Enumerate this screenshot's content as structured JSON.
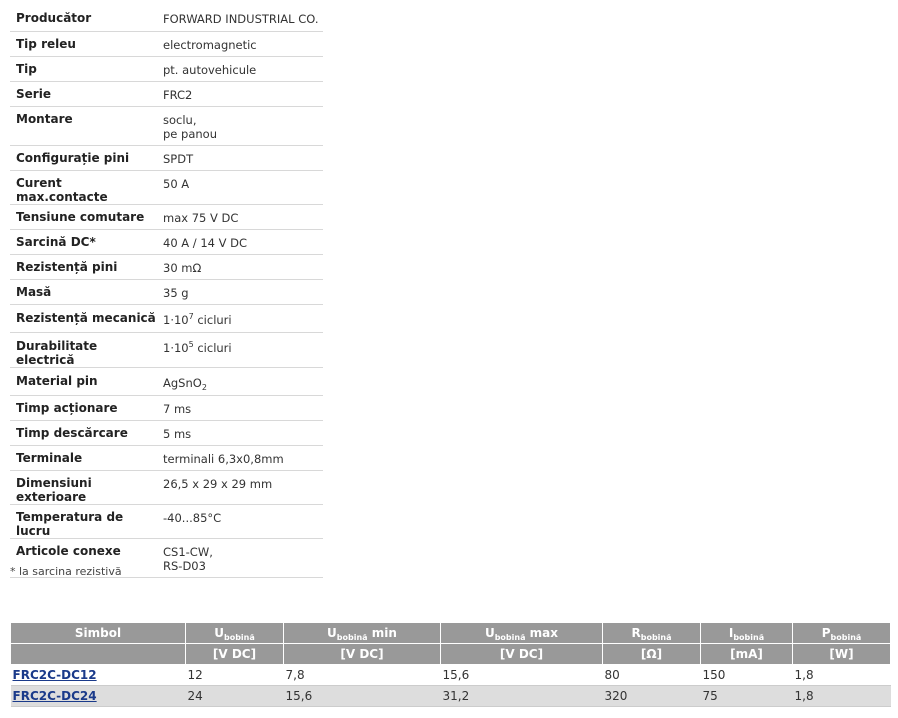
{
  "specs": [
    {
      "key": "Producător",
      "value": "FORWARD INDUSTRIAL CO."
    },
    {
      "key": "Tip releu",
      "value": "electromagnetic"
    },
    {
      "key": "Tip",
      "value": "pt. autovehicule"
    },
    {
      "key": "Serie",
      "value": "FRC2"
    },
    {
      "key": "Montare",
      "value": "soclu,",
      "value2": "pe panou"
    },
    {
      "key": "Configurație pini",
      "value": "SPDT"
    },
    {
      "key": "Curent max.contacte",
      "value": "50 A"
    },
    {
      "key": "Tensiune comutare",
      "value": "max 75 V DC"
    },
    {
      "key": "Sarcină DC*",
      "value": "40 A / 14 V DC"
    },
    {
      "key": "Rezistență pini",
      "value": "30 mΩ"
    },
    {
      "key": "Masă",
      "value": "35 g"
    },
    {
      "key": "Rezistență mecanică",
      "base": "1·10",
      "exp": "7",
      "unit": " cicluri"
    },
    {
      "key": "Durabilitate electrică",
      "base": "1·10",
      "exp": "5",
      "unit": " cicluri"
    },
    {
      "key": "Material pin",
      "base": "AgSnO",
      "sub": "2"
    },
    {
      "key": "Timp acționare",
      "value": "7 ms"
    },
    {
      "key": "Timp descărcare",
      "value": "5 ms"
    },
    {
      "key": "Terminale",
      "value": "terminali 6,3x0,8mm"
    },
    {
      "key": "Dimensiuni exterioare",
      "value": "26,5 x 29 x 29 mm"
    },
    {
      "key": "Temperatura de lucru",
      "value": "-40...85°C"
    },
    {
      "key": "Articole conexe",
      "value": "CS1-CW,",
      "value2": "RS-D03"
    }
  ],
  "footnote": "* la sarcina rezistivă",
  "models": {
    "headers": [
      {
        "main": "Simbol"
      },
      {
        "main": "U",
        "sub": "bobină",
        "suffix": ""
      },
      {
        "main": "U",
        "sub": "bobină",
        "suffix": " min"
      },
      {
        "main": "U",
        "sub": "bobină",
        "suffix": " max"
      },
      {
        "main": "R",
        "sub": "bobină",
        "suffix": ""
      },
      {
        "main": "I",
        "sub": "bobină",
        "suffix": ""
      },
      {
        "main": "P",
        "sub": "bobină",
        "suffix": ""
      }
    ],
    "units": [
      "",
      "[V DC]",
      "[V DC]",
      "[V DC]",
      "[Ω]",
      "[mA]",
      "[W]"
    ],
    "rows": [
      {
        "symbol": "FRC2C-DC12",
        "cells": [
          "12",
          "7,8",
          "15,6",
          "80",
          "150",
          "1,8"
        ]
      },
      {
        "symbol": "FRC2C-DC24",
        "cells": [
          "24",
          "15,6",
          "31,2",
          "320",
          "75",
          "1,8"
        ]
      }
    ]
  }
}
